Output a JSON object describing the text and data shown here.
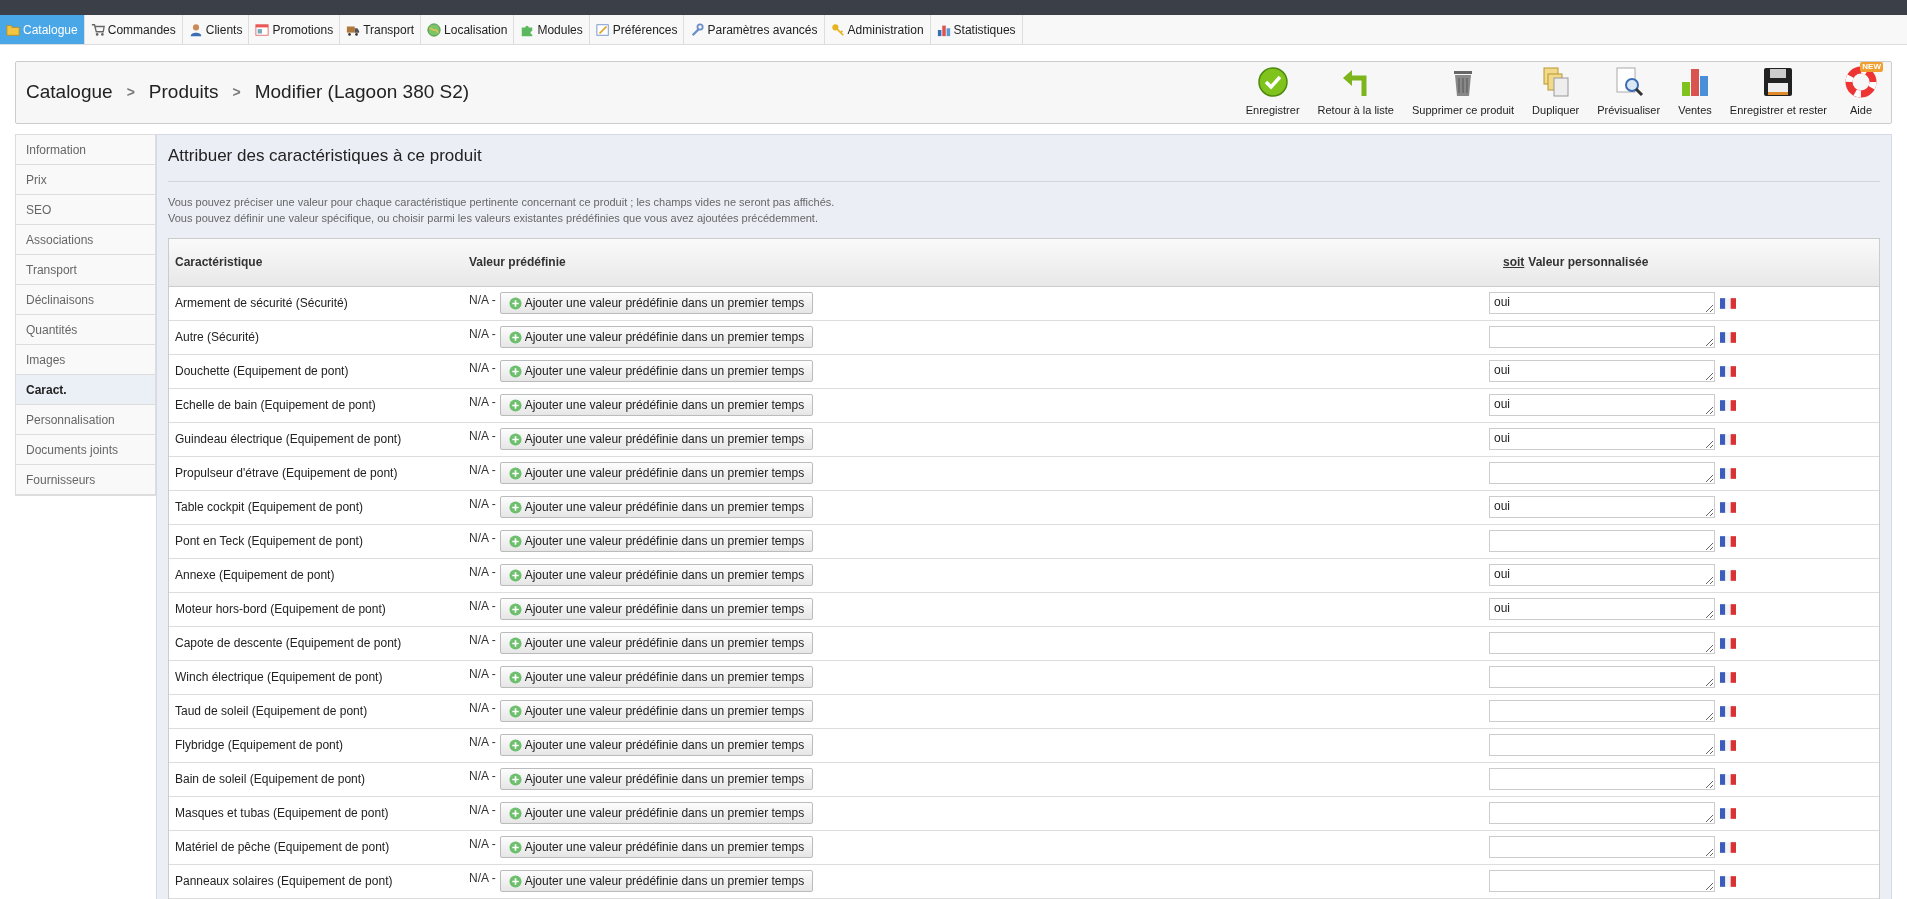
{
  "menu": [
    {
      "label": "Catalogue",
      "kind": "folder",
      "selected": true
    },
    {
      "label": "Commandes",
      "kind": "cart",
      "selected": false
    },
    {
      "label": "Clients",
      "kind": "person",
      "selected": false
    },
    {
      "label": "Promotions",
      "kind": "promo",
      "selected": false
    },
    {
      "label": "Transport",
      "kind": "truck",
      "selected": false
    },
    {
      "label": "Localisation",
      "kind": "globe",
      "selected": false
    },
    {
      "label": "Modules",
      "kind": "puzzle",
      "selected": false
    },
    {
      "label": "Préférences",
      "kind": "prefs",
      "selected": false
    },
    {
      "label": "Paramètres avancés",
      "kind": "wrench",
      "selected": false
    },
    {
      "label": "Administration",
      "kind": "key",
      "selected": false
    },
    {
      "label": "Statistiques",
      "kind": "stats",
      "selected": false
    }
  ],
  "breadcrumb": [
    "Catalogue",
    "Produits",
    "Modifier (Lagoon 380 S2)"
  ],
  "breadcrumb_separator": ">",
  "toolbar": [
    {
      "label": "Enregistrer",
      "kind": "save"
    },
    {
      "label": "Retour à la liste",
      "kind": "back"
    },
    {
      "label": "Supprimer ce produit",
      "kind": "delete"
    },
    {
      "label": "Dupliquer",
      "kind": "duplicate"
    },
    {
      "label": "Prévisualiser",
      "kind": "preview"
    },
    {
      "label": "Ventes",
      "kind": "sales"
    },
    {
      "label": "Enregistrer et rester",
      "kind": "savestay"
    },
    {
      "label": "Aide",
      "kind": "help",
      "badge": "NEW"
    }
  ],
  "sidebar": [
    {
      "label": "Information",
      "selected": false
    },
    {
      "label": "Prix",
      "selected": false
    },
    {
      "label": "SEO",
      "selected": false
    },
    {
      "label": "Associations",
      "selected": false
    },
    {
      "label": "Transport",
      "selected": false
    },
    {
      "label": "Déclinaisons",
      "selected": false
    },
    {
      "label": "Quantités",
      "selected": false
    },
    {
      "label": "Images",
      "selected": false
    },
    {
      "label": "Caract.",
      "selected": true
    },
    {
      "label": "Personnalisation",
      "selected": false
    },
    {
      "label": "Documents joints",
      "selected": false
    },
    {
      "label": "Fournisseurs",
      "selected": false
    }
  ],
  "panel": {
    "title": "Attribuer des caractéristiques à ce produit",
    "description": [
      "Vous pouvez préciser une valeur pour chaque caractéristique pertinente concernant ce produit ; les champs vides ne seront pas affichés.",
      "Vous pouvez définir une valeur spécifique, ou choisir parmi les valeurs existantes prédéfinies que vous avez ajoutées précédemment."
    ]
  },
  "table": {
    "columns": [
      "Caractéristique",
      "Valeur prédéfinie",
      {
        "link": "soit",
        "label": "Valeur personnalisée"
      }
    ],
    "rows": [
      {
        "feature": "Armement de sécurité (Sécurité)",
        "predefined": "N/A -",
        "button": "Ajouter une valeur prédéfinie dans un premier temps",
        "value": "oui"
      },
      {
        "feature": "Autre (Sécurité)",
        "predefined": "N/A -",
        "button": "Ajouter une valeur prédéfinie dans un premier temps"
      },
      {
        "feature": "Douchette (Equipement de pont)",
        "predefined": "N/A -",
        "button": "Ajouter une valeur prédéfinie dans un premier temps",
        "value": "oui"
      },
      {
        "feature": "Echelle de bain (Equipement de pont)",
        "predefined": "N/A -",
        "button": "Ajouter une valeur prédéfinie dans un premier temps",
        "value": "oui"
      },
      {
        "feature": "Guindeau électrique (Equipement de pont)",
        "predefined": "N/A -",
        "button": "Ajouter une valeur prédéfinie dans un premier temps",
        "value": "oui"
      },
      {
        "feature": "Propulseur d'étrave (Equipement de pont)",
        "predefined": "N/A -",
        "button": "Ajouter une valeur prédéfinie dans un premier temps"
      },
      {
        "feature": "Table cockpit (Equipement de pont)",
        "predefined": "N/A -",
        "button": "Ajouter une valeur prédéfinie dans un premier temps",
        "value": "oui"
      },
      {
        "feature": "Pont en Teck (Equipement de pont)",
        "predefined": "N/A -",
        "button": "Ajouter une valeur prédéfinie dans un premier temps"
      },
      {
        "feature": "Annexe (Equipement de pont)",
        "predefined": "N/A -",
        "button": "Ajouter une valeur prédéfinie dans un premier temps",
        "value": "oui"
      },
      {
        "feature": "Moteur hors-bord (Equipement de pont)",
        "predefined": "N/A -",
        "button": "Ajouter une valeur prédéfinie dans un premier temps",
        "value": "oui"
      },
      {
        "feature": "Capote de descente (Equipement de pont)",
        "predefined": "N/A -",
        "button": "Ajouter une valeur prédéfinie dans un premier temps"
      },
      {
        "feature": "Winch électrique (Equipement de pont)",
        "predefined": "N/A -",
        "button": "Ajouter une valeur prédéfinie dans un premier temps"
      },
      {
        "feature": "Taud de soleil (Equipement de pont)",
        "predefined": "N/A -",
        "button": "Ajouter une valeur prédéfinie dans un premier temps"
      },
      {
        "feature": "Flybridge (Equipement de pont)",
        "predefined": "N/A -",
        "button": "Ajouter une valeur prédéfinie dans un premier temps"
      },
      {
        "feature": "Bain de soleil (Equipement de pont)",
        "predefined": "N/A -",
        "button": "Ajouter une valeur prédéfinie dans un premier temps"
      },
      {
        "feature": "Masques et tubas (Equipement de pont)",
        "predefined": "N/A -",
        "button": "Ajouter une valeur prédéfinie dans un premier temps"
      },
      {
        "feature": "Matériel de pêche (Equipement de pont)",
        "predefined": "N/A -",
        "button": "Ajouter une valeur prédéfinie dans un premier temps"
      },
      {
        "feature": "Panneaux solaires (Equipement de pont)",
        "predefined": "N/A -",
        "button": "Ajouter une valeur prédéfinie dans un premier temps"
      }
    ]
  }
}
